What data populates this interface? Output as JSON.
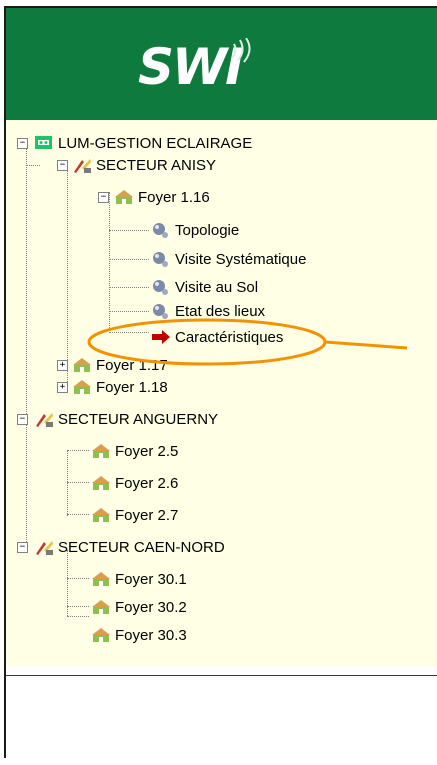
{
  "header": {
    "logo_text": "SWI",
    "logo_icon": "radio-waves-icon",
    "background": "#0f7a3e"
  },
  "tree": {
    "root": {
      "label": "LUM-GESTION ECLAIRAGE",
      "icon": "network-icon"
    },
    "sectors": [
      {
        "label": "SECTEUR ANISY",
        "icon": "sector-tools-icon"
      },
      {
        "label": "SECTEUR ANGUERNY",
        "icon": "sector-tools-icon"
      },
      {
        "label": "SECTEUR CAEN-NORD",
        "icon": "sector-tools-icon"
      }
    ],
    "foyers_anisy": [
      "Foyer 1.16",
      "Foyer 1.17",
      "Foyer 1.18"
    ],
    "foyer_children": [
      "Topologie",
      "Visite Systématique",
      "Visite au Sol",
      "Etat des lieux",
      "Caractéristiques"
    ],
    "foyers_anguerny": [
      "Foyer 2.5",
      "Foyer 2.6",
      "Foyer 2.7"
    ],
    "foyers_caen": [
      "Foyer 30.1",
      "Foyer 30.2",
      "Foyer 30.3"
    ]
  },
  "colors": {
    "panel_bg": "#ffffe6",
    "highlight": "#f39200",
    "arrow": "#c00000"
  }
}
